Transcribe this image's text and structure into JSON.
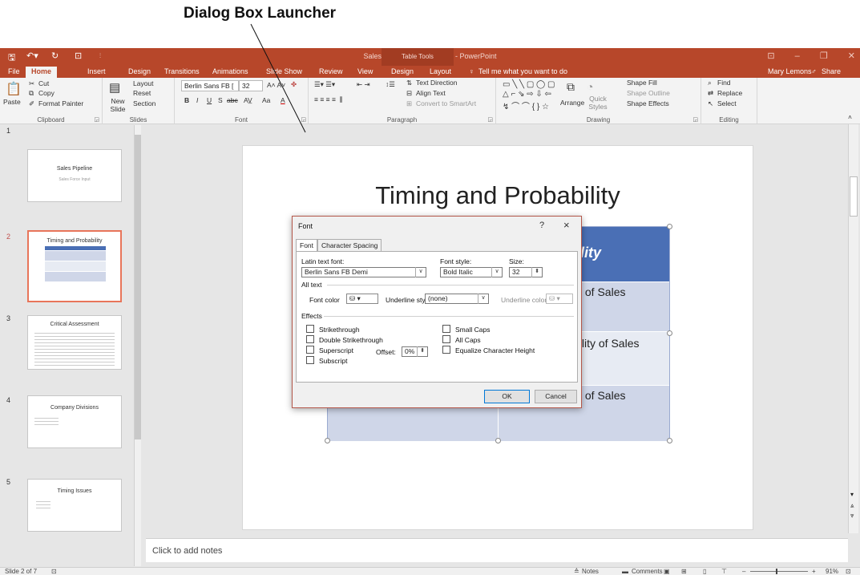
{
  "callout": {
    "label": "Dialog Box Launcher"
  },
  "app": {
    "window_title": "Sales Pipeline Formats.pptx - PowerPoint",
    "table_tools": "Table Tools",
    "user": "Mary Lemons",
    "share": "Share",
    "tabs": [
      "File",
      "Home",
      "Insert",
      "Design",
      "Transitions",
      "Animations",
      "Slide Show",
      "Review",
      "View",
      "Design",
      "Layout"
    ],
    "tell_me": "Tell me what you want to do"
  },
  "ribbon": {
    "clipboard": {
      "paste": "Paste",
      "cut": "Cut",
      "copy": "Copy",
      "format_painter": "Format Painter",
      "label": "Clipboard"
    },
    "slides": {
      "new_slide": "New Slide",
      "layout": "Layout",
      "reset": "Reset",
      "section": "Section",
      "label": "Slides"
    },
    "font": {
      "font_name": "Berlin Sans FB [",
      "font_size": "32",
      "aa": "Aa",
      "label": "Font"
    },
    "paragraph": {
      "text_direction": "Text Direction",
      "align_text": "Align Text",
      "convert_smartart": "Convert to SmartArt",
      "label": "Paragraph"
    },
    "drawing": {
      "arrange": "Arrange",
      "quick_styles": "Quick Styles",
      "shape_fill": "Shape Fill",
      "shape_outline": "Shape Outline",
      "shape_effects": "Shape Effects",
      "label": "Drawing"
    },
    "editing": {
      "find": "Find",
      "replace": "Replace",
      "select": "Select",
      "label": "Editing"
    }
  },
  "thumbnails": [
    {
      "num": "1",
      "title": "Sales Pipeline",
      "sub": "Sales Force Input"
    },
    {
      "num": "2",
      "title": "Timing and Probability"
    },
    {
      "num": "3",
      "title": "Critical Assessment"
    },
    {
      "num": "4",
      "title": "Company Divisions"
    },
    {
      "num": "5",
      "title": "Timing Issues"
    }
  ],
  "slide": {
    "title": "Timing and Probability",
    "header_fragment": "ility",
    "rows": [
      "y of Sales",
      "bility of Sales",
      "y of Sales"
    ]
  },
  "notes": {
    "placeholder": "Click to add notes"
  },
  "status": {
    "slide_count": "Slide 2 of 7",
    "notes": "Notes",
    "comments": "Comments",
    "zoom": "91%"
  },
  "dialog": {
    "title": "Font",
    "help": "?",
    "close": "×",
    "tabs": [
      "Font",
      "Character Spacing"
    ],
    "latin_label": "Latin text font:",
    "latin_value": "Berlin Sans FB Demi",
    "style_label": "Font style:",
    "style_value": "Bold Italic",
    "size_label": "Size:",
    "size_value": "32",
    "all_text": "All text",
    "font_color_label": "Font color",
    "underline_style_label": "Underline style",
    "underline_style_value": "(none)",
    "underline_color_label": "Underline color",
    "effects": "Effects",
    "strikethrough": "Strikethrough",
    "double_strikethrough": "Double Strikethrough",
    "superscript": "Superscript",
    "offset_label": "Offset:",
    "offset_value": "0%",
    "subscript": "Subscript",
    "small_caps": "Small Caps",
    "all_caps": "All Caps",
    "equalize": "Equalize Character Height",
    "ok": "OK",
    "cancel": "Cancel"
  }
}
